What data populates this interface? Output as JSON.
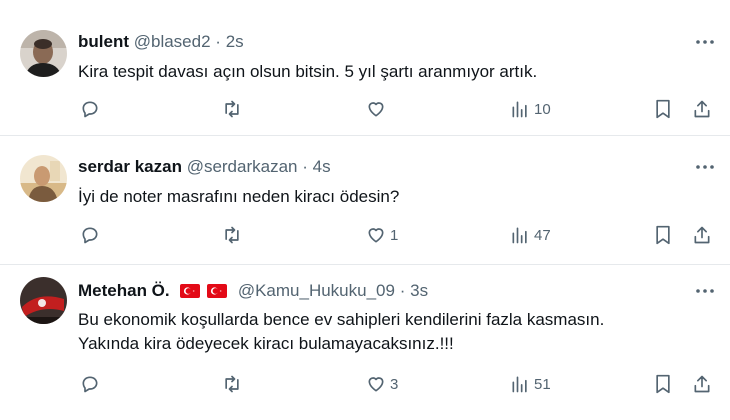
{
  "tweets": [
    {
      "name": "bulent",
      "handle": "@blased2",
      "separator": "·",
      "time": "2s",
      "lines": [
        "Kira tespit davası açın olsun bitsin. 5 yıl şartı aranmıyor artık."
      ],
      "likes": "",
      "views": "10"
    },
    {
      "name": "serdar kazan",
      "handle": "@serdarkazan",
      "separator": "·",
      "time": "4s",
      "lines": [
        "İyi de noter masrafını neden kiracı ödesin?"
      ],
      "likes": "1",
      "views": "47"
    },
    {
      "name": "Metehan Ö.",
      "handle": "@Kamu_Hukuku_09",
      "separator": "·",
      "time": "3s",
      "lines": [
        "Bu ekonomik koşullarda bence ev sahipleri kendilerini fazla kasmasın.",
        "Yakında kira ödeyecek kiracı bulamayacaksınız.!!!"
      ],
      "likes": "3",
      "views": "51"
    }
  ],
  "colors": {
    "text": "#0f1419",
    "secondary": "#536471",
    "divider": "#e6e9ec",
    "flag_red": "#e30a17"
  },
  "icons": [
    "reply-icon",
    "retweet-icon",
    "like-icon",
    "views-icon",
    "bookmark-icon",
    "share-icon",
    "more-icon",
    "turkey-flag-icon"
  ]
}
